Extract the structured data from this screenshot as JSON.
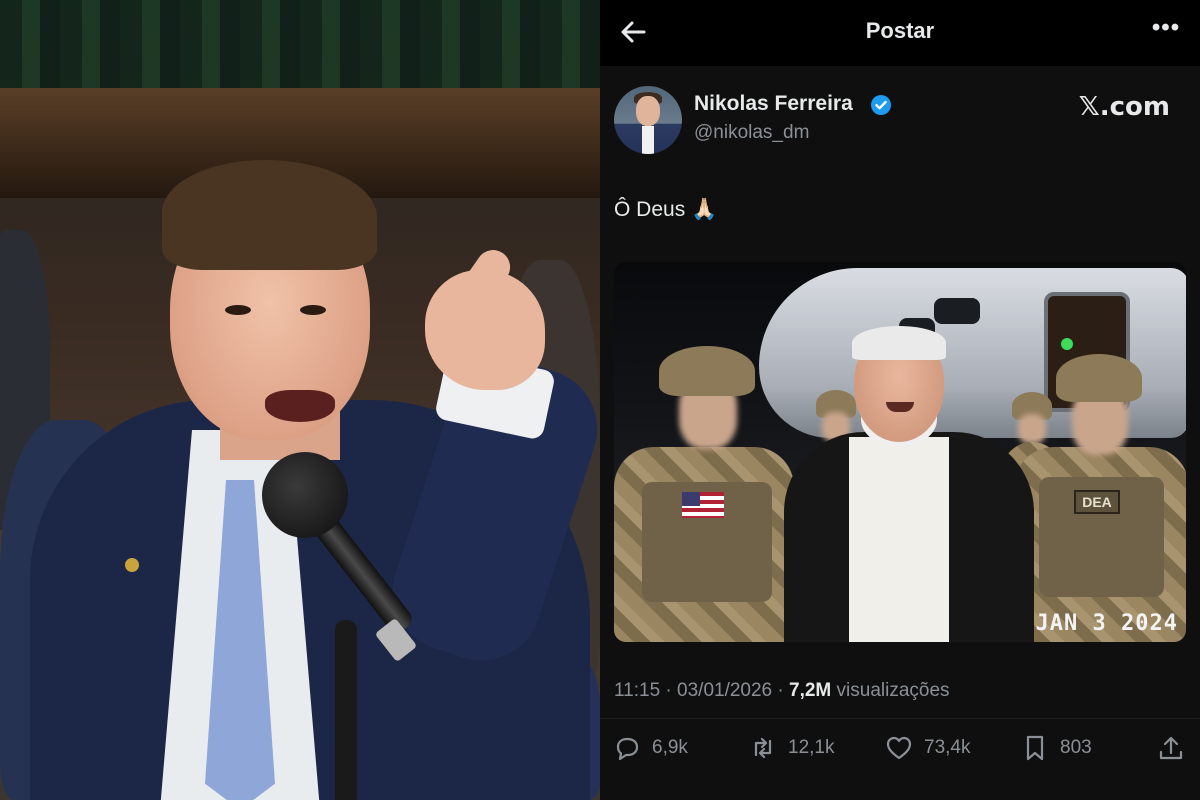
{
  "topbar": {
    "title": "Postar",
    "back_icon": "arrow-left-icon",
    "more_icon": "more-horizontal-icon",
    "more_label": "•••"
  },
  "post": {
    "author": {
      "display_name": "Nikolas Ferreira",
      "handle": "@nikolas_dm",
      "verified": true,
      "verified_color": "#1d9bf0"
    },
    "brand": "𝕏.com",
    "text": "Ô Deus 🙏🏻",
    "image": {
      "date_stamp": "JAN 3 2024",
      "patch_text": "DEA"
    },
    "meta": {
      "time": "11:15",
      "separator": "·",
      "date": "03/01/2026",
      "separator2": "·",
      "views_count": "7,2M",
      "views_label": "visualizações"
    },
    "actions": {
      "replies": "6,9k",
      "reposts": "12,1k",
      "likes": "73,4k",
      "bookmarks": "803"
    }
  },
  "colors": {
    "background": "#000000",
    "card": "#0f0f0f",
    "text_primary": "#e7e9ea",
    "text_secondary": "#8b9096"
  }
}
